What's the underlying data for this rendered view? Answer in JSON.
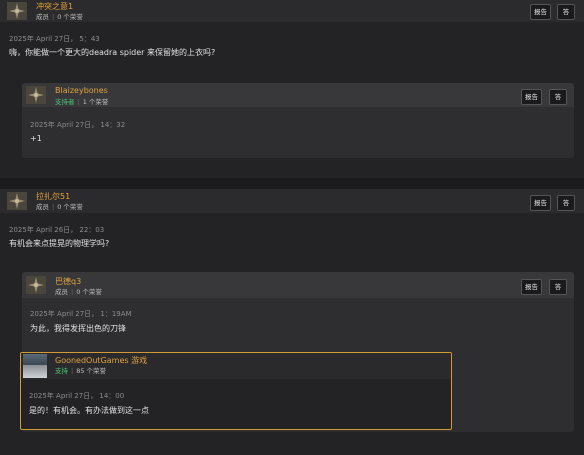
{
  "thread": [
    {
      "id": "p1",
      "username": "冲突之意1",
      "role": "成员",
      "honors": "0 个荣誉",
      "report_label": "报告",
      "reply_label": "答",
      "date": "2025年 April 27日， 5：43",
      "text": "嗨，你能做一个更大的deadra spider 来保留她的上衣吗?",
      "quote": {
        "username": "Blaizeybones",
        "role": "支持者",
        "honors": "1 个荣誉",
        "report_label": "报告",
        "reply_label": "答",
        "date": "2025年 April 27日， 14：32",
        "text": "+1"
      }
    },
    {
      "id": "p2",
      "username": "拉扎尔51",
      "role": "成员",
      "honors": "0 个荣誉",
      "report_label": "报告",
      "reply_label": "答",
      "date": "2025年 April 26日， 22：03",
      "text": "有机会来点提晃的物理学吗?",
      "quote": {
        "username": "巴德q3",
        "role": "成员",
        "honors": "0 个荣誉",
        "report_label": "报告",
        "reply_label": "答",
        "date": "2025年 April 27日， 1：19AM",
        "text": "为此，我得发挥出色的刀锋",
        "nested": {
          "username": "GoonedOutGames 游戏",
          "role": "支持",
          "honors": "85 个荣誉",
          "date": "2025年 April 27日， 14：00",
          "text": "是的！有机会。有办法做到这一点"
        }
      }
    }
  ],
  "colors": {
    "username": "#e0a23c",
    "supporter": "#48c774",
    "highlight_border": "#d19a35"
  },
  "icons": {
    "avatar": "compass-emblem-icon"
  }
}
